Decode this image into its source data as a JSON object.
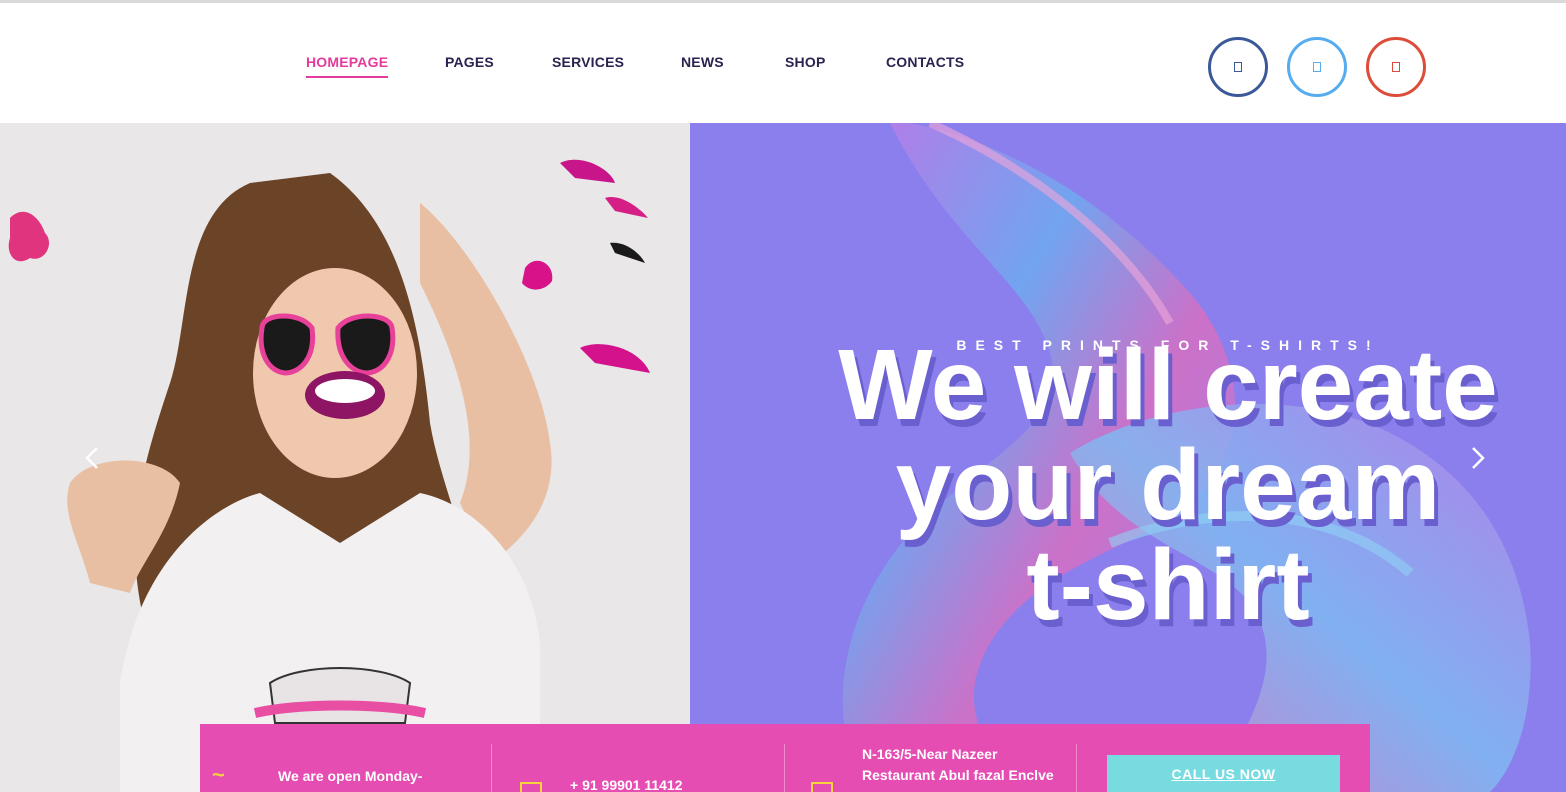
{
  "nav": {
    "items": [
      {
        "label": "HOMEPAGE",
        "active": true
      },
      {
        "label": "PAGES",
        "active": false
      },
      {
        "label": "SERVICES",
        "active": false
      },
      {
        "label": "NEWS",
        "active": false
      },
      {
        "label": "SHOP",
        "active": false
      },
      {
        "label": "CONTACTS",
        "active": false
      }
    ]
  },
  "social": [
    {
      "icon": "facebook-icon",
      "color": "#3b5998"
    },
    {
      "icon": "twitter-icon",
      "color": "#55acee"
    },
    {
      "icon": "google-plus-icon",
      "color": "#dd4b39"
    }
  ],
  "hero": {
    "kicker": "BEST PRINTS FOR T-SHIRTS!",
    "headline": [
      "We will create",
      "your dream",
      "t-shirt"
    ],
    "purple": "#8a7fec",
    "prev_icon": "chevron-left-icon",
    "next_icon": "chevron-right-icon"
  },
  "info_bar": {
    "hours": "We are open Monday-",
    "phone": "+ 91 99901 11412",
    "address_line1": "N-163/5-Near Nazeer",
    "address_line2": "Restaurant Abul fazal Enclve",
    "cta": "CALL US NOW",
    "bar_color": "#e64db3",
    "cta_color": "#78dbe0",
    "accent": "#f5d33a"
  },
  "colors": {
    "accent": "#e5399b",
    "nav_text": "#2b2250"
  }
}
